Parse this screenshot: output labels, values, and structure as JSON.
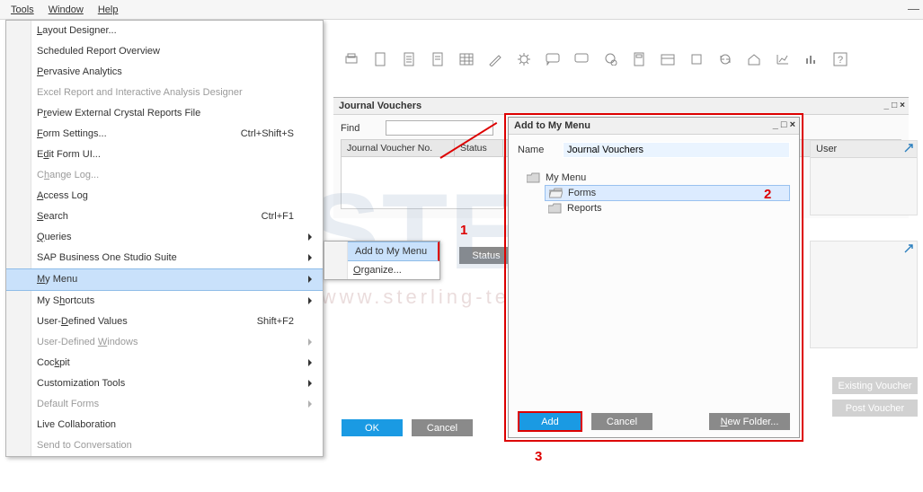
{
  "menubar": {
    "tools": "Tools",
    "window": "Window",
    "help": "Help"
  },
  "tools_menu": {
    "layout_designer": "Layout Designer...",
    "sched_report": "Scheduled Report Overview",
    "pervasive": "Pervasive Analytics",
    "excel_report": "Excel Report and Interactive Analysis Designer",
    "preview_crystal": "Preview External Crystal Reports File",
    "form_settings": "Form Settings...",
    "form_settings_kb": "Ctrl+Shift+S",
    "edit_form_ui": "Edit Form UI...",
    "change_log": "Change Log...",
    "access_log": "Access Log",
    "search": "Search",
    "search_kb": "Ctrl+F1",
    "queries": "Queries",
    "studio_suite": "SAP Business One Studio Suite",
    "my_menu": "My Menu",
    "my_shortcuts": "My Shortcuts",
    "udv": "User-Defined Values",
    "udv_kb": "Shift+F2",
    "udw": "User-Defined Windows",
    "cockpit": "Cockpit",
    "custom_tools": "Customization Tools",
    "default_forms": "Default Forms",
    "live_collab": "Live Collaboration",
    "send_conv": "Send to Conversation"
  },
  "submenu": {
    "add_to_my_menu": "Add to My Menu",
    "organize": "Organize..."
  },
  "jv": {
    "title": "Journal Vouchers",
    "find": "Find",
    "col_no": "Journal Voucher No.",
    "col_status": "Status",
    "btn_status": "Status",
    "ok": "OK",
    "cancel": "Cancel"
  },
  "sidecard": {
    "user_label": "User",
    "existing": "Existing Voucher",
    "post": "Post Voucher"
  },
  "addmm": {
    "title": "Add to My Menu",
    "name_label": "Name",
    "name_value": "Journal Vouchers",
    "tree_root": "My Menu",
    "tree_forms": "Forms",
    "tree_reports": "Reports",
    "btn_add": "Add",
    "btn_cancel": "Cancel",
    "btn_new_folder": "New Folder..."
  },
  "annotations": {
    "one": "1",
    "two": "2",
    "three": "3"
  },
  "watermark": {
    "main": "STEM",
    "sub": "www.sterling-team.com",
    "reg": "®"
  },
  "colors": {
    "accent": "#dd0000",
    "highlight": "#c9e1fb",
    "primary_btn": "#1a9ae3"
  }
}
